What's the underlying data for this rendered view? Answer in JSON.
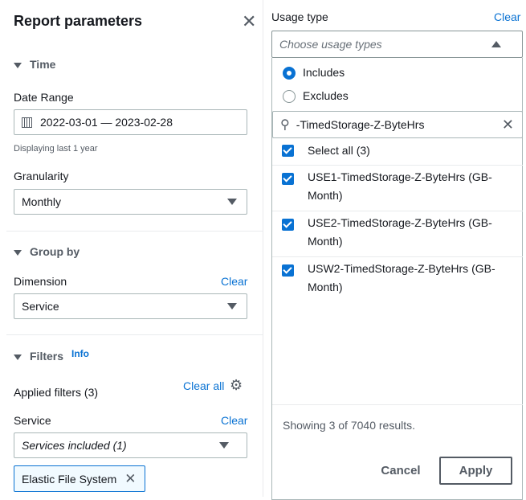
{
  "panel": {
    "title": "Report parameters",
    "time": {
      "heading": "Time",
      "date_range_label": "Date Range",
      "date_range_value": "2022-03-01 — 2023-02-28",
      "hint": "Displaying last 1 year",
      "granularity_label": "Granularity",
      "granularity_value": "Monthly"
    },
    "group_by": {
      "heading": "Group by",
      "dimension_label": "Dimension",
      "clear": "Clear",
      "dimension_value": "Service"
    },
    "filters": {
      "heading": "Filters",
      "info": "Info",
      "applied": "Applied filters (3)",
      "clear_all": "Clear all",
      "service_label": "Service",
      "clear": "Clear",
      "service_value": "Services included (1)",
      "token": "Elastic File System"
    }
  },
  "usage": {
    "label": "Usage type",
    "clear": "Clear",
    "placeholder": "Choose usage types",
    "includes": "Includes",
    "excludes": "Excludes",
    "search_value": "-TimedStorage-Z-ByteHrs",
    "select_all": "Select all (3)",
    "options": [
      "USE1-TimedStorage-Z-ByteHrs (GB-Month)",
      "USE2-TimedStorage-Z-ByteHrs (GB-Month)",
      "USW2-TimedStorage-Z-ByteHrs (GB-Month)"
    ],
    "results": "Showing 3 of 7040 results.",
    "cancel": "Cancel",
    "apply": "Apply"
  }
}
